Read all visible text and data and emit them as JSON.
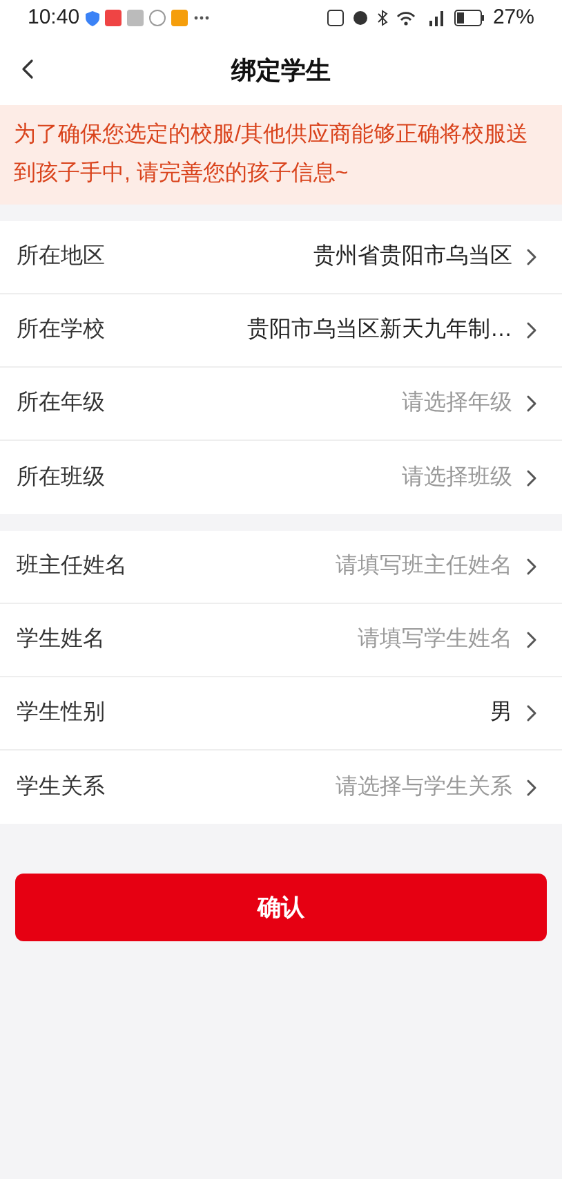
{
  "status_bar": {
    "time": "10:40",
    "battery": "27%"
  },
  "header": {
    "title": "绑定学生"
  },
  "notice": "为了确保您选定的校服/其他供应商能够正确将校服送到孩子手中, 请完善您的孩子信息~",
  "groups": [
    {
      "rows": [
        {
          "label": "所在地区",
          "value": "贵州省贵阳市乌当区"
        },
        {
          "label": "所在学校",
          "value": "贵阳市乌当区新天九年制…"
        },
        {
          "label": "所在年级",
          "placeholder": "请选择年级"
        },
        {
          "label": "所在班级",
          "placeholder": "请选择班级"
        }
      ]
    },
    {
      "rows": [
        {
          "label": "班主任姓名",
          "placeholder": "请填写班主任姓名"
        },
        {
          "label": "学生姓名",
          "placeholder": "请填写学生姓名"
        },
        {
          "label": "学生性别",
          "value": "男"
        },
        {
          "label": "学生关系",
          "placeholder": "请选择与学生关系"
        }
      ]
    }
  ],
  "confirm_button": "确认"
}
